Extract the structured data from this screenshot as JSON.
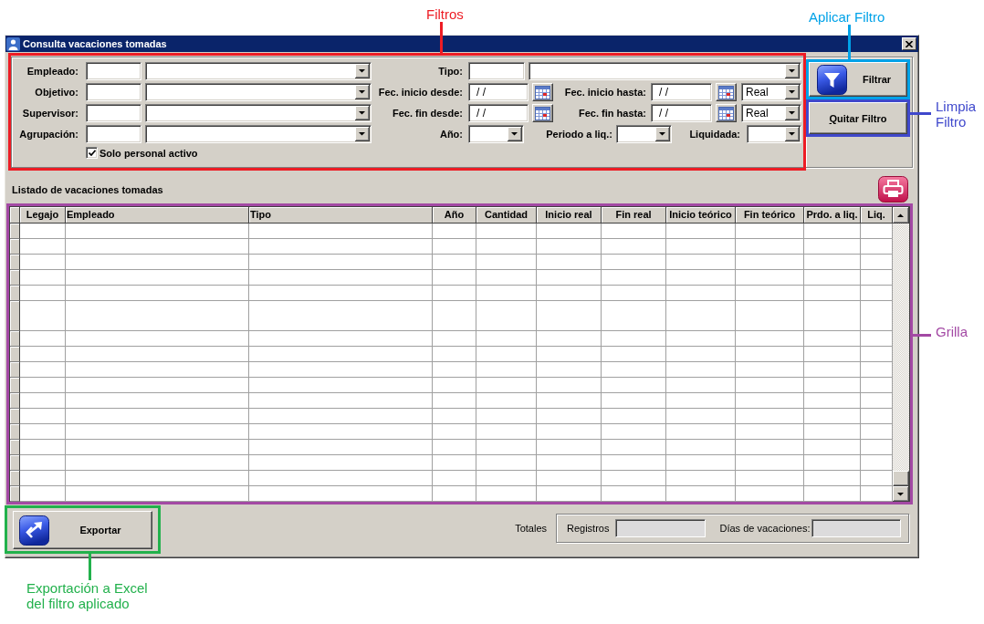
{
  "window": {
    "title": "Consulta vacaciones tomadas"
  },
  "filters": {
    "people": [
      {
        "label": "Empleado:"
      },
      {
        "label": "Objetivo:"
      },
      {
        "label": "Supervisor:"
      },
      {
        "label": "Agrupación:"
      }
    ],
    "tipo": {
      "label": "Tipo:"
    },
    "date_ranges": [
      {
        "from_label": "Fec. inicio desde:",
        "from_value": "/ /",
        "to_label": "Fec. inicio hasta:",
        "to_value": "/ /",
        "mode": "Real"
      },
      {
        "from_label": "Fec. fin desde:",
        "from_value": "/ /",
        "to_label": "Fec. fin hasta:",
        "to_value": "/ /",
        "mode": "Real"
      }
    ],
    "year": {
      "label": "Año:"
    },
    "period": {
      "label": "Periodo a liq.:"
    },
    "settled": {
      "label": "Liquidada:"
    },
    "active_only": {
      "label": "Solo personal activo",
      "checked": true
    }
  },
  "actions": {
    "filter": {
      "label": "Filtrar"
    },
    "clear": {
      "label": "Quitar Filtro",
      "access_key_underlined": true
    }
  },
  "list": {
    "title": "Listado de vacaciones tomadas",
    "columns": [
      "Legajo",
      "Empleado",
      "Tipo",
      "Año",
      "Cantidad",
      "Inicio real",
      "Fin real",
      "Inicio teórico",
      "Fin teórico",
      "Prdo. a liq.",
      "Liq."
    ]
  },
  "export": {
    "label": "Exportar"
  },
  "totals": {
    "title": "Totales",
    "records": {
      "label": "Registros"
    },
    "vacation_days": {
      "label": "Días de vacaciones:"
    }
  },
  "annotations": [
    {
      "label": "Filtros",
      "color": "#ed1c24"
    },
    {
      "label": "Aplicar Filtro",
      "color": "#00a2e8"
    },
    {
      "label": "Limpia Filtro",
      "color": "#3f48cc"
    },
    {
      "label": "Grilla",
      "color": "#a349a4"
    },
    {
      "label": "Exportación a Excel del filtro aplicado",
      "color": "#22b14c"
    }
  ]
}
